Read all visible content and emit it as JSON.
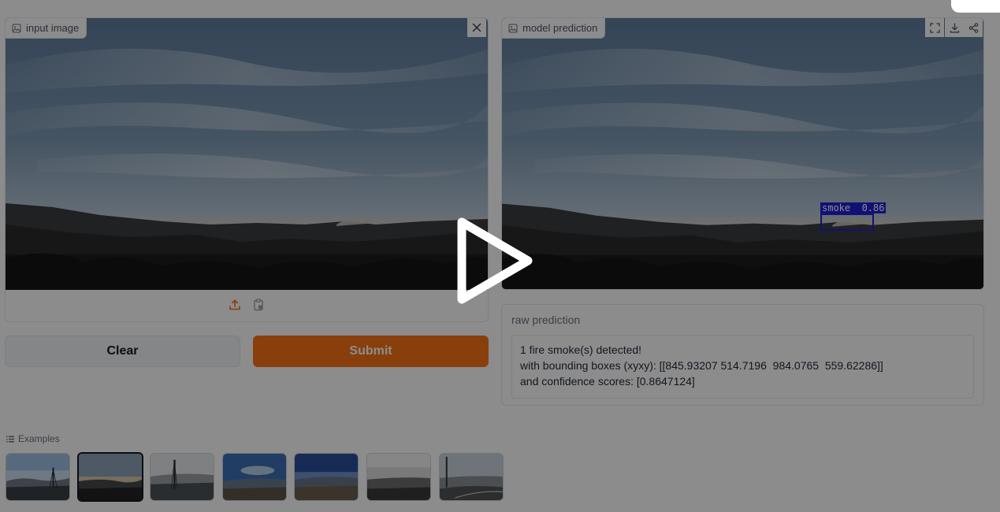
{
  "input_panel": {
    "label": "input image",
    "label_icon": "image-icon",
    "close_icon": "close-icon",
    "upload_icon": "upload-icon",
    "clipboard_icon": "clipboard-icon"
  },
  "output_panel": {
    "label": "model prediction",
    "label_icon": "image-icon",
    "toolbar_icons": [
      "fullscreen-icon",
      "download-icon",
      "share-icon"
    ],
    "detection": {
      "class_name": "smoke",
      "confidence": 0.86,
      "label_text": "smoke  0.86",
      "color": "#1f1fd6"
    }
  },
  "buttons": {
    "clear_label": "Clear",
    "submit_label": "Submit",
    "submit_color": "#f97316"
  },
  "raw_prediction": {
    "label": "raw prediction",
    "lines": [
      "1 fire smoke(s) detected!",
      "with bounding boxes (xyxy): [[845.93207 514.7196  984.0765  559.62286]]",
      "and confidence scores: [0.8647124]"
    ]
  },
  "examples": {
    "title": "Examples",
    "title_icon": "list-icon",
    "count": 7,
    "selected_index": 1
  },
  "video_overlay": {
    "play_icon": "play-icon"
  }
}
